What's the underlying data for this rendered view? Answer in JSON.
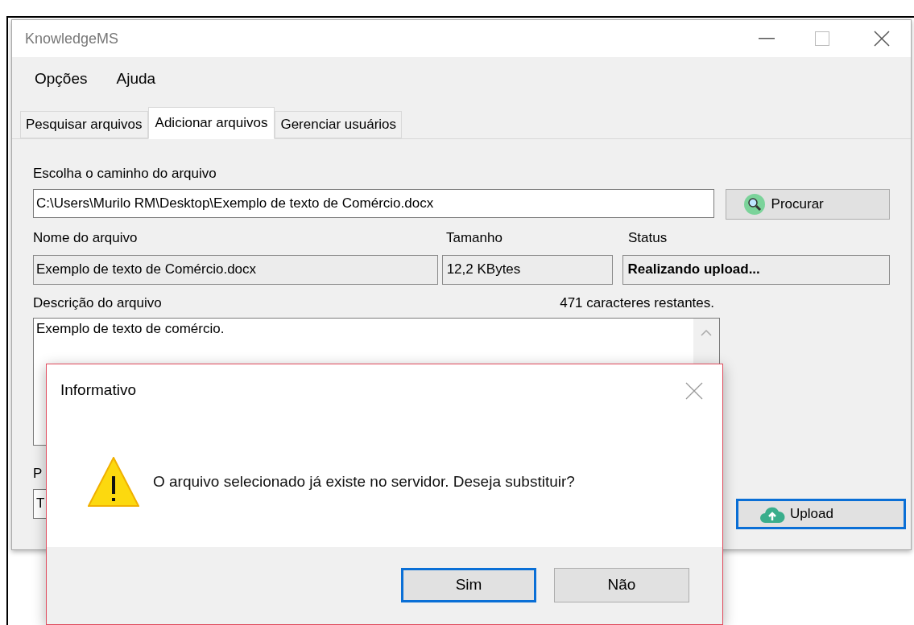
{
  "window": {
    "title": "KnowledgeMS"
  },
  "menu": [
    "Opções",
    "Ajuda"
  ],
  "tabs": [
    {
      "label": "Pesquisar arquivos",
      "selected": false
    },
    {
      "label": "Adicionar arquivos",
      "selected": true
    },
    {
      "label": "Gerenciar usuários",
      "selected": false
    }
  ],
  "form": {
    "path_label": "Escolha o caminho do arquivo",
    "path_value": "C:\\Users\\Murilo RM\\Desktop\\Exemplo de texto de Comércio.docx",
    "browse_button": "Procurar",
    "name_label": "Nome do arquivo",
    "name_value": "Exemplo de texto de Comércio.docx",
    "size_label": "Tamanho",
    "size_value": "12,2 KBytes",
    "status_label": "Status",
    "status_value": "Realizando upload...",
    "description_label": "Descrição do arquivo",
    "char_counter": "471 caracteres restantes.",
    "description_value": "Exemplo de texto de comércio.",
    "field_4_label": "P",
    "field_4_value": "T",
    "upload_button": {
      "label": "Upload",
      "focused": true
    }
  },
  "dialog": {
    "title": "Informativo",
    "message": "O arquivo selecionado já existe no servidor. Deseja substituir?",
    "buttons": [
      {
        "label": "Sim",
        "default": true
      },
      {
        "label": "Não",
        "default": false
      }
    ]
  }
}
